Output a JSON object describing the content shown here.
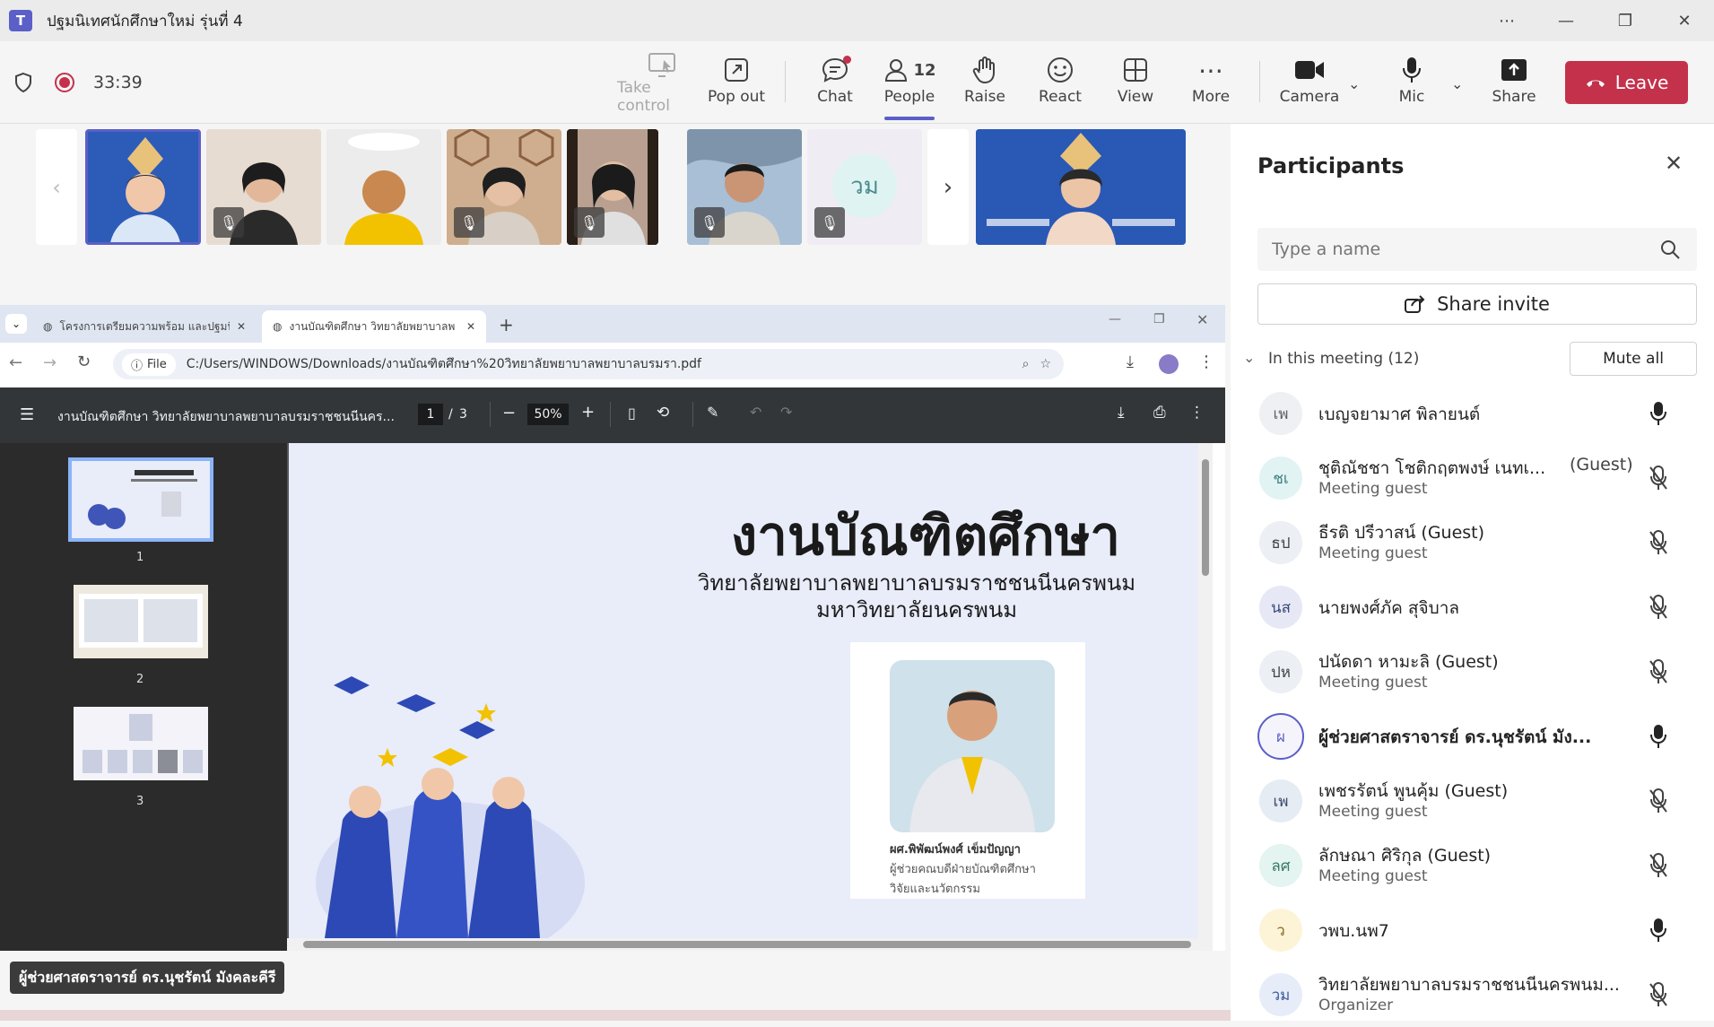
{
  "window": {
    "app_icon": "T",
    "title": "ปฐมนิเทศนักศึกษาใหม่ รุ่นที่ 4"
  },
  "toolbar": {
    "timer": "33:39",
    "take_control": "Take control",
    "pop_out": "Pop out",
    "chat": "Chat",
    "people": "People",
    "people_count": "12",
    "raise": "Raise",
    "react": "React",
    "view": "View",
    "more": "More",
    "camera": "Camera",
    "mic": "Mic",
    "share": "Share",
    "leave": "Leave"
  },
  "video_strip": {
    "avatar_initials": "วม"
  },
  "browser": {
    "tabs": [
      {
        "label": "โครงการเตรียมความพร้อม และปฐมนิ"
      },
      {
        "label": "งานบัณฑิตศึกษา วิทยาลัยพยาบาลพ"
      }
    ],
    "file_chip": "File",
    "url": "C:/Users/WINDOWS/Downloads/งานบัณฑิตศึกษา%20วิทยาลัยพยาบาลพยาบาลบรมรา.pdf",
    "pdf": {
      "title": "งานบัณฑิตศึกษา วิทยาลัยพยาบาลพยาบาลบรมราชชนนีนคร...",
      "page": "1",
      "page_sep": "/",
      "page_total": "3",
      "zoom": "50%",
      "thumbs": [
        "1",
        "2",
        "3"
      ],
      "slide": {
        "heading": "งานบัณฑิตศึกษา",
        "sub1": "วิทยาลัยพยาบาลพยาบาลบรมราชชนนีนครพนม",
        "sub2": "มหาวิทยาลัยนครพนม",
        "person_name": "ผศ.พิพัฒน์พงศ์ เข็มปัญญา",
        "person_role1": "ผู้ช่วยคณบดีฝ่ายบัณฑิตศึกษา",
        "person_role2": "วิจัยและนวัตกรรม"
      }
    }
  },
  "speaker_label": "ผู้ช่วยศาสดราจารย์ ดร.นุชรัตน์ มังคละคีรี",
  "participants": {
    "title": "Participants",
    "search_placeholder": "Type a name",
    "share_invite": "Share invite",
    "section_label": "In this meeting (12)",
    "mute_all": "Mute all",
    "list": [
      {
        "initials": "เพ",
        "name": "เบญจยามาศ พิลายนต์",
        "guest": "",
        "sub": "",
        "mic": "on"
      },
      {
        "initials": "ชเ",
        "name": "ชุติณัชชา โชติกฤตพงษ์ เนทเ...",
        "guest": "(Guest)",
        "sub": "Meeting guest",
        "mic": "off"
      },
      {
        "initials": "ธป",
        "name": "ธีรติ ปรีวาสน์ (Guest)",
        "guest": "",
        "sub": "Meeting guest",
        "mic": "off"
      },
      {
        "initials": "นส",
        "name": "นายพงศ์ภัค สุจิบาล",
        "guest": "",
        "sub": "",
        "mic": "off"
      },
      {
        "initials": "ปห",
        "name": "ปนัดดา หามะลิ (Guest)",
        "guest": "",
        "sub": "Meeting guest",
        "mic": "off"
      },
      {
        "initials": "ผ",
        "name": "ผู้ช่วยศาสตราจารย์ ดร.นุชรัตน์ มัง...",
        "guest": "",
        "sub": "",
        "mic": "on"
      },
      {
        "initials": "เพ",
        "name": "เพชรรัตน์ พูนคุ้ม (Guest)",
        "guest": "",
        "sub": "Meeting guest",
        "mic": "off"
      },
      {
        "initials": "ลศ",
        "name": "ลักษณา ศิริกุล (Guest)",
        "guest": "",
        "sub": "Meeting guest",
        "mic": "off"
      },
      {
        "initials": "ว",
        "name": "วพบ.นพ7",
        "guest": "",
        "sub": "",
        "mic": "on"
      },
      {
        "initials": "วม",
        "name": "วิทยาลัยพยาบาลบรมราชชนนีนครพนม...",
        "guest": "",
        "sub": "Organizer",
        "mic": "off"
      }
    ]
  },
  "colors": {
    "accent": "#5b5fc7",
    "leave": "#c4314b",
    "record": "#c4314b"
  }
}
